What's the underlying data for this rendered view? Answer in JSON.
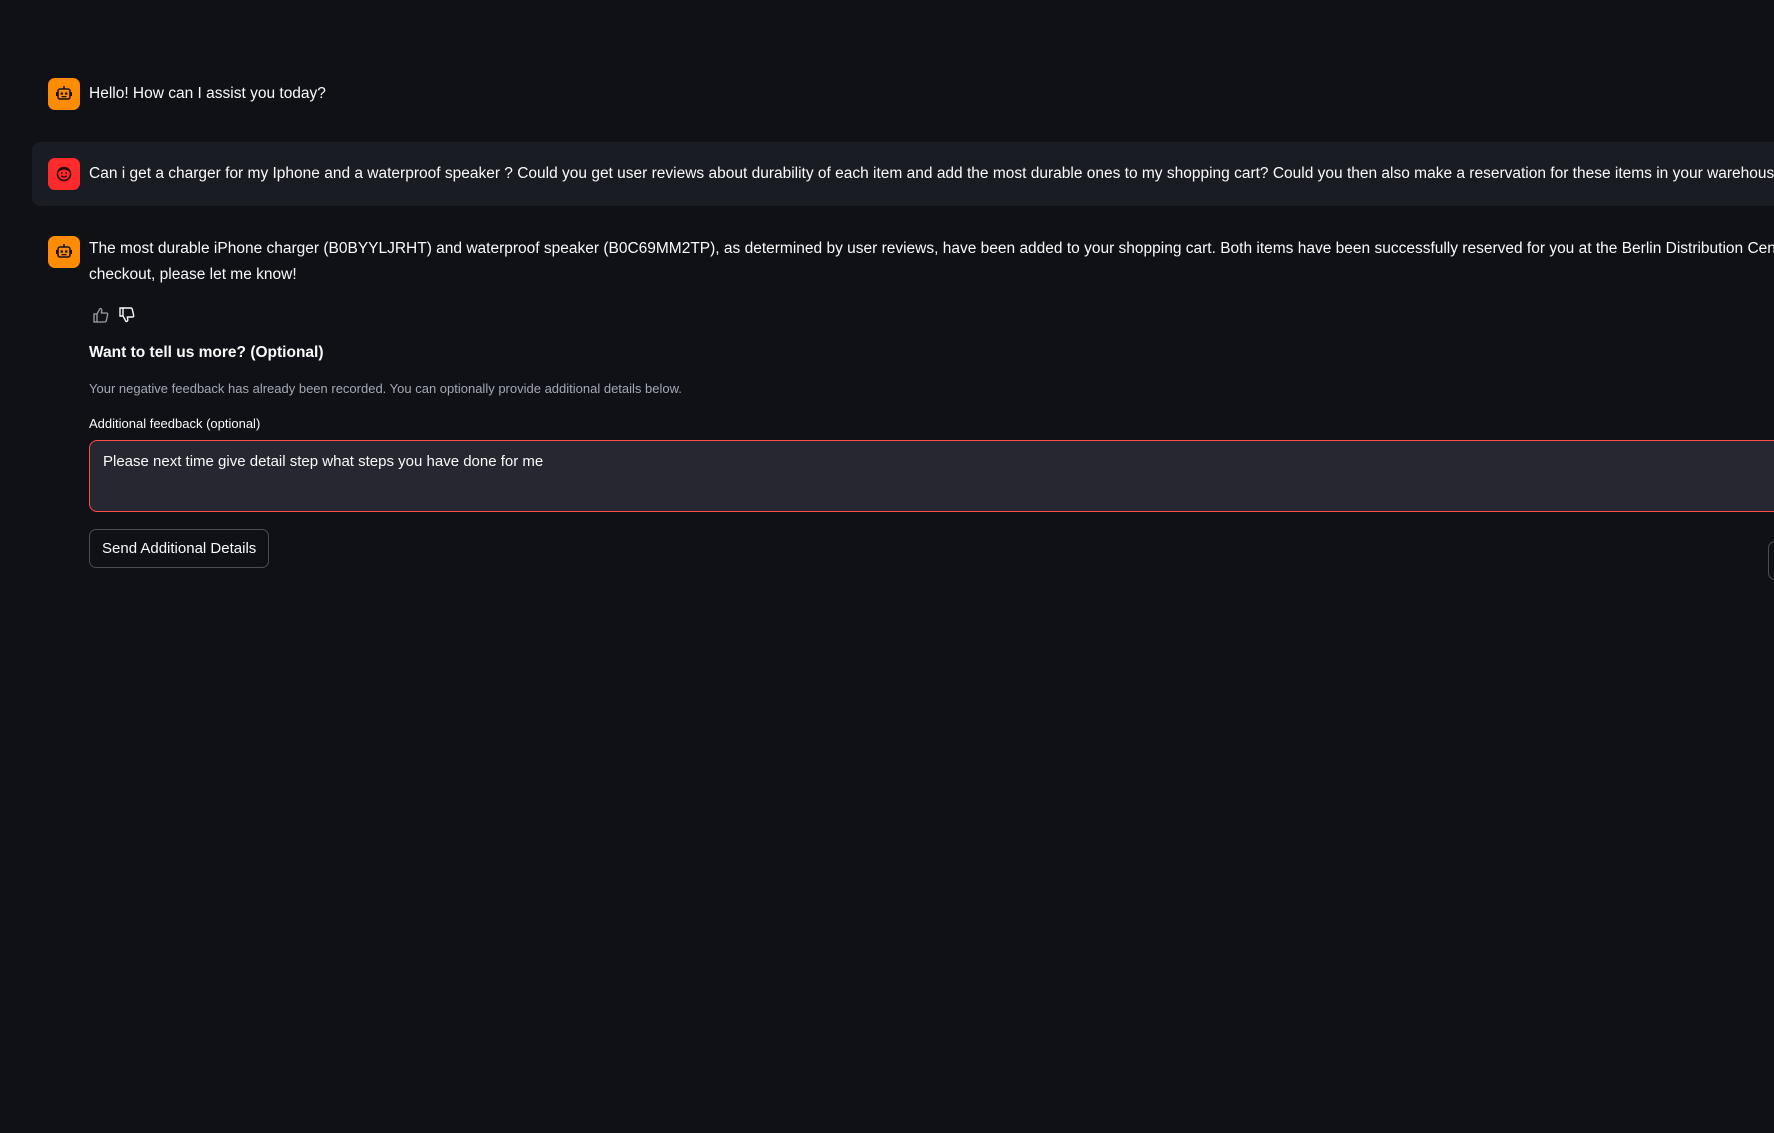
{
  "messages": [
    {
      "role": "assistant",
      "text": "Hello! How can I assist you today?"
    },
    {
      "role": "user",
      "text": "Can i get a charger for my Iphone and a waterproof speaker ? Could you get user reviews about durability of each item and add the most durable ones to my shopping cart? Could you then also make a reservation for these items in your warehouses?"
    },
    {
      "role": "assistant",
      "line1": "The most durable iPhone charger (B0BYYLJRHT) and waterproof speaker (B0C69MM2TP), as determined by user reviews, have been added to your shopping cart. Both items have been successfully reserved for you at the Berlin Distribution Center (DE-BER-",
      "line2": "checkout, please let me know!"
    }
  ],
  "feedback": {
    "heading": "Want to tell us more? (Optional)",
    "note": "Your negative feedback has already been recorded. You can optionally provide additional details below.",
    "field_label": "Additional feedback (optional)",
    "field_value": "Please next time give detail step what steps you have done for me",
    "send_label": "Send Additional Details"
  },
  "colors": {
    "background": "#0f1117",
    "bot_avatar": "#ff8c00",
    "user_avatar": "#ff2b2b",
    "input_border": "#ff4b4b"
  },
  "icons": {
    "bot_avatar": "robot-icon",
    "user_avatar": "smiley-face-icon",
    "thumbs_up": "thumbs-up-icon",
    "thumbs_down": "thumbs-down-icon"
  }
}
